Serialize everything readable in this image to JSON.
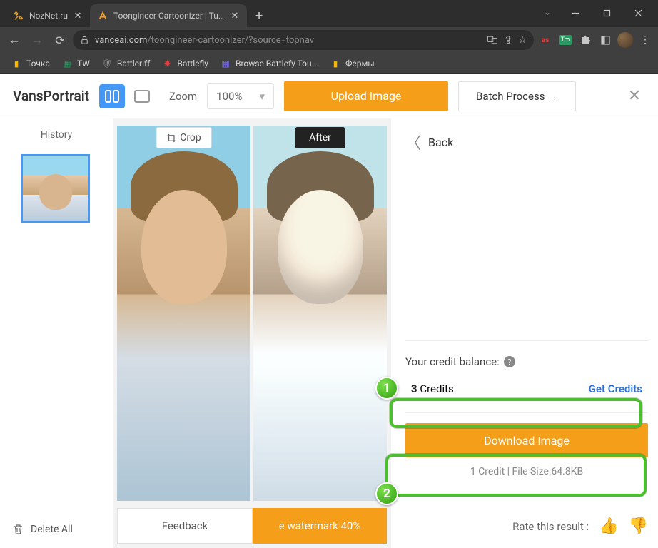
{
  "browser": {
    "tabs": [
      {
        "title": "NozNet.ru",
        "active": false
      },
      {
        "title": "Toongineer Cartoonizer | Turn Ph",
        "active": true
      }
    ],
    "url_host": "vanceai.com",
    "url_path": "/toongineer-cartoonizer/?source=topnav",
    "bookmarks": [
      "Точка",
      "TW",
      "Battleriff",
      "Battlefly",
      "Browse Battlefy Tou...",
      "Фермы"
    ]
  },
  "header": {
    "app_title": "VansPortrait",
    "zoom_label": "Zoom",
    "zoom_value": "100%",
    "upload_label": "Upload Image",
    "batch_label": "Batch Process →"
  },
  "sidebar": {
    "history_label": "History",
    "delete_all_label": "Delete All"
  },
  "compare": {
    "crop_label": "Crop",
    "after_label": "After"
  },
  "bottom": {
    "feedback_label": "Feedback",
    "watermark_label": "e watermark 40%"
  },
  "right": {
    "back_label": "Back",
    "balance_label": "Your credit balance:",
    "credits_count": "3",
    "credits_word": "Credits",
    "get_credits": "Get Credits",
    "download_label": "Download Image",
    "file_info": "1 Credit | File Size:64.8KB",
    "rate_label": "Rate this result :"
  },
  "annotations": {
    "one": "1",
    "two": "2"
  }
}
